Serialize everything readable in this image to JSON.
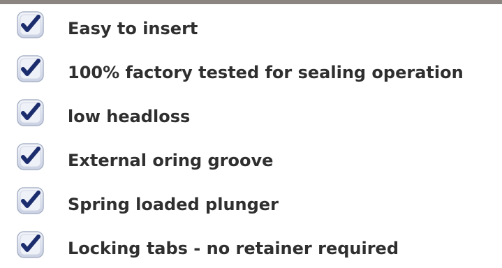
{
  "features": {
    "icon": "checkbox-checked-icon",
    "items": [
      {
        "label": "Easy to insert"
      },
      {
        "label": "100% factory tested for sealing operation"
      },
      {
        "label": "low headloss"
      },
      {
        "label": "External oring groove"
      },
      {
        "label": "Spring loaded plunger"
      },
      {
        "label": "Locking tabs - no retainer required"
      }
    ]
  }
}
